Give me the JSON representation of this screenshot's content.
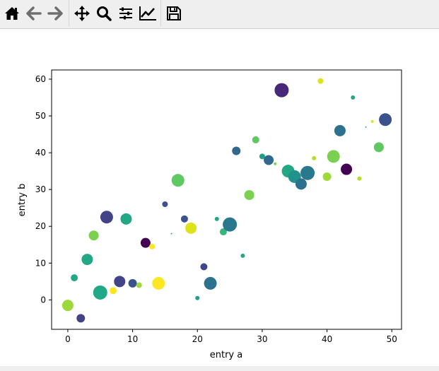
{
  "toolbar": {
    "items": [
      {
        "name": "home-icon",
        "label": "Home"
      },
      {
        "name": "back-icon",
        "label": "Back"
      },
      {
        "name": "forward-icon",
        "label": "Forward"
      },
      {
        "name": "pan-icon",
        "label": "Pan"
      },
      {
        "name": "zoom-icon",
        "label": "Zoom"
      },
      {
        "name": "subplots-icon",
        "label": "Subplots"
      },
      {
        "name": "customize-icon",
        "label": "Customize"
      },
      {
        "name": "save-icon",
        "label": "Save"
      }
    ]
  },
  "chart_data": {
    "type": "scatter",
    "title": "",
    "xlabel": "entry a",
    "ylabel": "entry b",
    "xlim": [
      -2.5,
      51.5
    ],
    "ylim": [
      -8,
      62.5
    ],
    "xticks": [
      0,
      10,
      20,
      30,
      40,
      50
    ],
    "yticks": [
      0,
      10,
      20,
      30,
      40,
      50,
      60
    ],
    "grid": false,
    "colormap": "viridis",
    "points": [
      {
        "x": 0,
        "y": -1.5,
        "size": 8,
        "color": "#9ed93a"
      },
      {
        "x": 1,
        "y": 6,
        "size": 5,
        "color": "#22a884"
      },
      {
        "x": 2,
        "y": -5,
        "size": 6,
        "color": "#414487"
      },
      {
        "x": 3,
        "y": 11,
        "size": 8,
        "color": "#22a884"
      },
      {
        "x": 4,
        "y": 17.5,
        "size": 7,
        "color": "#7ad151"
      },
      {
        "x": 5,
        "y": 2,
        "size": 10,
        "color": "#22a884"
      },
      {
        "x": 6,
        "y": 22.5,
        "size": 9,
        "color": "#414487"
      },
      {
        "x": 7,
        "y": 2.5,
        "size": 5,
        "color": "#fde725"
      },
      {
        "x": 8,
        "y": 5,
        "size": 8,
        "color": "#414487"
      },
      {
        "x": 9,
        "y": 22,
        "size": 8,
        "color": "#22a884"
      },
      {
        "x": 10,
        "y": 4.5,
        "size": 6,
        "color": "#3b528b"
      },
      {
        "x": 11,
        "y": 4,
        "size": 4,
        "color": "#9ed93a"
      },
      {
        "x": 12,
        "y": 15.5,
        "size": 7,
        "color": "#440154"
      },
      {
        "x": 13,
        "y": 14.5,
        "size": 4,
        "color": "#fde725"
      },
      {
        "x": 14,
        "y": 4.5,
        "size": 9,
        "color": "#fde725"
      },
      {
        "x": 15,
        "y": 26,
        "size": 4,
        "color": "#3b528b"
      },
      {
        "x": 16,
        "y": 18,
        "size": 1,
        "color": "#22a884"
      },
      {
        "x": 17,
        "y": 32.5,
        "size": 9,
        "color": "#5ec962"
      },
      {
        "x": 18,
        "y": 22,
        "size": 5,
        "color": "#3b528b"
      },
      {
        "x": 19,
        "y": 19.5,
        "size": 8,
        "color": "#dde318"
      },
      {
        "x": 20,
        "y": 0.5,
        "size": 3,
        "color": "#1f9e89"
      },
      {
        "x": 21,
        "y": 9,
        "size": 5,
        "color": "#414487"
      },
      {
        "x": 22,
        "y": 4.5,
        "size": 9,
        "color": "#2c728e"
      },
      {
        "x": 23,
        "y": 22,
        "size": 3,
        "color": "#22a884"
      },
      {
        "x": 24,
        "y": 18.5,
        "size": 5,
        "color": "#35b779"
      },
      {
        "x": 25,
        "y": 20.5,
        "size": 10,
        "color": "#2a788e"
      },
      {
        "x": 26,
        "y": 40.5,
        "size": 6,
        "color": "#31688e"
      },
      {
        "x": 27,
        "y": 12,
        "size": 3,
        "color": "#22a884"
      },
      {
        "x": 28,
        "y": 28.5,
        "size": 7,
        "color": "#7ad151"
      },
      {
        "x": 29,
        "y": 43.5,
        "size": 5,
        "color": "#5ec962"
      },
      {
        "x": 30,
        "y": 39,
        "size": 4,
        "color": "#1f9e89"
      },
      {
        "x": 31,
        "y": 38,
        "size": 7,
        "color": "#31688e"
      },
      {
        "x": 32,
        "y": 37,
        "size": 2,
        "color": "#7ad151"
      },
      {
        "x": 33,
        "y": 57,
        "size": 10,
        "color": "#482878"
      },
      {
        "x": 34,
        "y": 35,
        "size": 9,
        "color": "#22a884"
      },
      {
        "x": 35,
        "y": 33.5,
        "size": 9,
        "color": "#21918c"
      },
      {
        "x": 36,
        "y": 31.5,
        "size": 8,
        "color": "#2c728e"
      },
      {
        "x": 37,
        "y": 34.5,
        "size": 10,
        "color": "#2a788e"
      },
      {
        "x": 38,
        "y": 38.5,
        "size": 3,
        "color": "#b5de2b"
      },
      {
        "x": 39,
        "y": 59.5,
        "size": 4,
        "color": "#dde318"
      },
      {
        "x": 40,
        "y": 33.5,
        "size": 6,
        "color": "#9ed93a"
      },
      {
        "x": 41,
        "y": 39,
        "size": 9,
        "color": "#7ad151"
      },
      {
        "x": 42,
        "y": 46,
        "size": 8,
        "color": "#2c728e"
      },
      {
        "x": 43,
        "y": 35.5,
        "size": 8,
        "color": "#440154"
      },
      {
        "x": 44,
        "y": 55,
        "size": 3,
        "color": "#22a884"
      },
      {
        "x": 45,
        "y": 33,
        "size": 3,
        "color": "#b5de2b"
      },
      {
        "x": 46,
        "y": 47,
        "size": 1,
        "color": "#22a884"
      },
      {
        "x": 47,
        "y": 48.5,
        "size": 2,
        "color": "#dde318"
      },
      {
        "x": 48,
        "y": 41.5,
        "size": 7,
        "color": "#5ec962"
      },
      {
        "x": 49,
        "y": 49,
        "size": 9,
        "color": "#3b528b"
      }
    ]
  }
}
